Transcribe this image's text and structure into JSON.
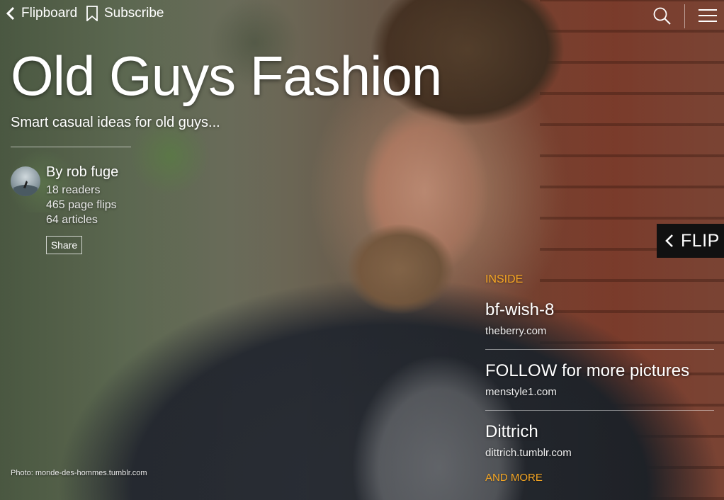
{
  "nav": {
    "back_label": "Flipboard",
    "subscribe_label": "Subscribe",
    "search_icon": "search-icon",
    "menu_icon": "hamburger-menu-icon"
  },
  "magazine": {
    "title": "Old Guys Fashion",
    "subtitle": "Smart casual ideas for old guys...",
    "author": "By rob fuge",
    "readers": "18 readers",
    "page_flips": "465 page flips",
    "articles": "64 articles",
    "share_label": "Share"
  },
  "flip": {
    "label": "FLIP"
  },
  "inside": {
    "label": "INSIDE",
    "items": [
      {
        "title": "bf-wish-8",
        "source": "theberry.com"
      },
      {
        "title": "FOLLOW for more pictures",
        "source": "menstyle1.com"
      },
      {
        "title": "Dittrich",
        "source": "dittrich.tumblr.com"
      }
    ],
    "more_label": "AND MORE"
  },
  "photo_credit": "Photo: monde-des-hommes.tumblr.com",
  "colors": {
    "accent": "#f5a623",
    "flip_bg": "#111111",
    "text": "#ffffff"
  }
}
